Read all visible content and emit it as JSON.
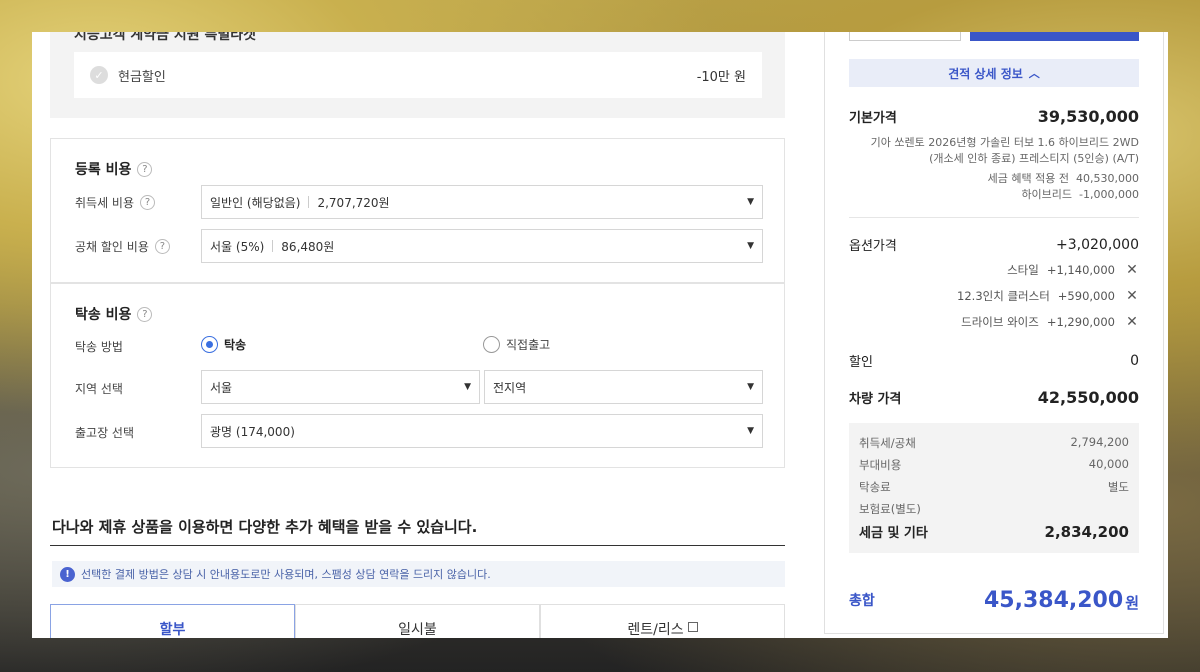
{
  "cash_discount": {
    "section_title_cut": "지능고객 계약금 지원 특별타겟",
    "label": "현금할인",
    "value": "-10만 원"
  },
  "registration": {
    "title": "등록 비용",
    "acq_tax_label": "취득세 비용",
    "acq_tax_select": "일반인 (해당없음)",
    "acq_tax_amount": "2,707,720원",
    "bond_label": "공채 할인 비용",
    "bond_select": "서울 (5%)",
    "bond_amount": "86,480원"
  },
  "delivery": {
    "title": "탁송 비용",
    "method_label": "탁송 방법",
    "option_delivery": "탁송",
    "option_pickup": "직접출고",
    "region_label": "지역 선택",
    "region_value": "서울",
    "region_sub_value": "전지역",
    "depot_label": "출고장 선택",
    "depot_value": "광명 (174,000)"
  },
  "promo": {
    "title": "다나와 제휴 상품을 이용하면 다양한 추가 혜택을 받을 수 있습니다.",
    "notice": "선택한 결제 방법은 상담 시 안내용도로만 사용되며, 스팸성 상담 연락을 드리지 않습니다.",
    "tabs": [
      "할부",
      "일시불",
      "렌트/리스"
    ]
  },
  "summary": {
    "detail_button": "견적 상세 정보",
    "base_price_label": "기본가격",
    "base_price_value": "39,530,000",
    "model_line1": "기아 쏘렌토 2026년형 가솔린 터보 1.6 하이브리드 2WD",
    "model_line2": "(개소세 인하 종료) 프레스티지 (5인승) (A/T)",
    "pretax_label": "세금 혜택 적용 전",
    "pretax_value": "40,530,000",
    "hybrid_label": "하이브리드",
    "hybrid_value": "-1,000,000",
    "option_label": "옵션가격",
    "option_value": "+3,020,000",
    "options": [
      {
        "name": "스타일",
        "price": "+1,140,000"
      },
      {
        "name": "12.3인치 클러스터",
        "price": "+590,000"
      },
      {
        "name": "드라이브 와이즈",
        "price": "+1,290,000"
      }
    ],
    "discount_label": "할인",
    "discount_value": "0",
    "vehicle_price_label": "차량 가격",
    "vehicle_price_value": "42,550,000",
    "tax_lines": [
      {
        "label": "취득세/공채",
        "value": "2,794,200"
      },
      {
        "label": "부대비용",
        "value": "40,000"
      },
      {
        "label": "탁송료",
        "value": "별도"
      },
      {
        "label": "보험료(별도)",
        "value": ""
      }
    ],
    "tax_total_label": "세금 및 기타",
    "tax_total_value": "2,834,200",
    "total_label": "총합",
    "total_value": "45,384,200",
    "total_unit": "원"
  }
}
